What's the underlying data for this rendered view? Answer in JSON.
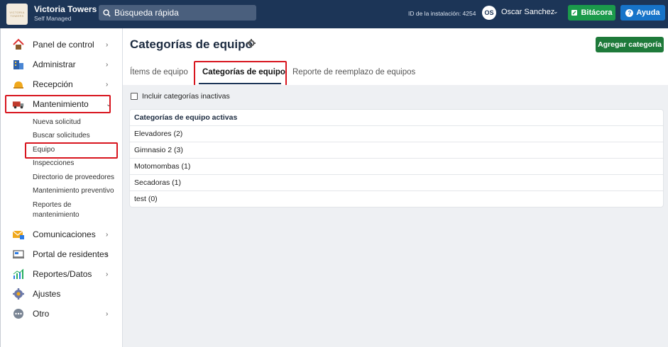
{
  "topbar": {
    "logo_text": "VICTORIA TOWERS",
    "brand_name": "Victoria Towers",
    "brand_sub": "Self Managed",
    "search_placeholder": "Búsqueda rápida",
    "install_id": "ID de la instalación: 4254",
    "avatar_initials": "OS",
    "user_name": "Oscar Sanchez",
    "bitacora_label": "Bitácora",
    "ayuda_label": "Ayuda"
  },
  "sidebar": {
    "items": [
      {
        "label": "Panel de control",
        "icon": "home-icon",
        "chevron": true
      },
      {
        "label": "Administrar",
        "icon": "building-icon",
        "chevron": true
      },
      {
        "label": "Recepción",
        "icon": "bell-icon",
        "chevron": true
      },
      {
        "label": "Mantenimiento",
        "icon": "truck-icon",
        "chevron": true
      },
      {
        "label": "Comunicaciones",
        "icon": "mail-icon",
        "chevron": true
      },
      {
        "label": "Portal de residentes",
        "icon": "laptop-icon",
        "chevron": true
      },
      {
        "label": "Reportes/Datos",
        "icon": "chart-icon",
        "chevron": true
      },
      {
        "label": "Ajustes",
        "icon": "gear-icon",
        "chevron": false
      },
      {
        "label": "Otro",
        "icon": "more-icon",
        "chevron": true
      }
    ],
    "subitems": [
      "Nueva solicitud",
      "Buscar solicitudes",
      "Equipo",
      "Inspecciones",
      "Directorio de proveedores",
      "Mantenimiento preventivo",
      "Reportes de",
      "mantenimiento"
    ]
  },
  "main": {
    "title": "Categorías de equipo",
    "add_button": "Agregar categoría",
    "tabs": [
      {
        "label": "Ítems de equipo",
        "active": false
      },
      {
        "label": "Categorías de equipo",
        "active": true
      },
      {
        "label": "Reporte de reemplazo de equipos",
        "active": false
      }
    ],
    "include_inactive_label": "Incluir categorías inactivas",
    "include_inactive_checked": false,
    "table": {
      "header": "Categorías de equipo activas",
      "rows": [
        "Elevadores (2)",
        "Gimnasio 2 (3)",
        "Motomombas (1)",
        "Secadoras (1)",
        "test (0)"
      ]
    }
  },
  "colors": {
    "topbar": "#1c3557",
    "highlight": "#d8151e",
    "bitacora": "#1b9a4b",
    "ayuda": "#1774c9",
    "add_button": "#1e7a3a"
  }
}
